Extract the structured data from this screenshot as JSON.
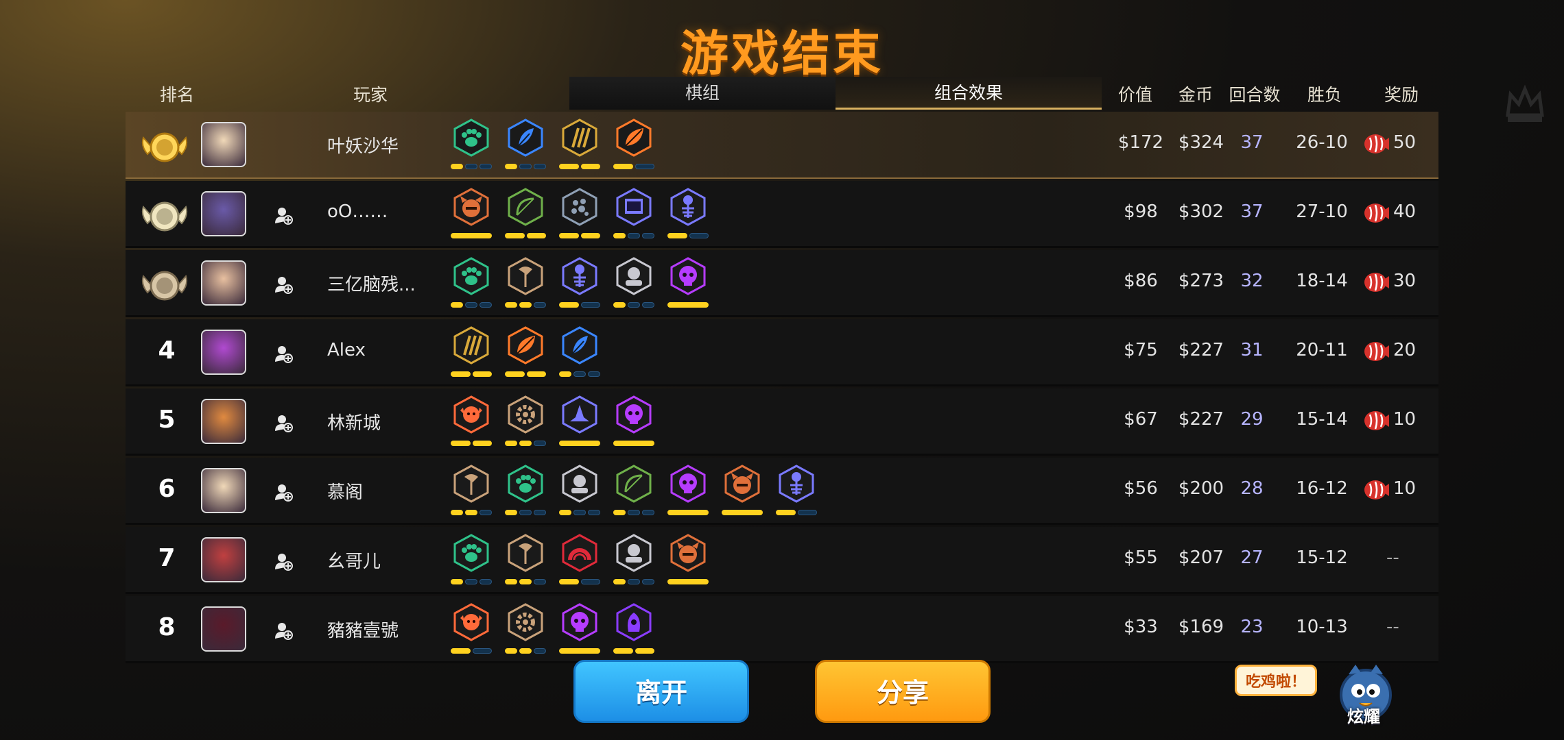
{
  "title": "游戏结束",
  "headers": {
    "rank": "排名",
    "player": "玩家",
    "value": "价值",
    "gold": "金币",
    "rounds": "回合数",
    "winloss": "胜负",
    "reward": "奖励"
  },
  "tabs": {
    "deck": "棋组",
    "synergy": "组合效果"
  },
  "colors": {
    "title": "#ff9a1f",
    "active_bar": "#ffd21f",
    "inactive_bar": "#13324d",
    "round_text": "#b7b5ff"
  },
  "players": [
    {
      "rank": "1",
      "medal": "gold",
      "name": "叶妖沙华",
      "value": "$172",
      "gold": "$324",
      "rounds": "37",
      "record": "26-10",
      "reward": "50",
      "synergies": [
        {
          "icon": "paw",
          "color": "#2fc28a",
          "bars": [
            1,
            0,
            0
          ]
        },
        {
          "icon": "feather",
          "color": "#3a86ff",
          "bars": [
            1,
            0,
            0
          ]
        },
        {
          "icon": "claw",
          "color": "#d9a93a",
          "bars": [
            1,
            1
          ]
        },
        {
          "icon": "leaf",
          "color": "#ff7a2a",
          "bars": [
            1,
            0
          ]
        }
      ]
    },
    {
      "rank": "2",
      "medal": "silver",
      "name": "oO……",
      "value": "$98",
      "gold": "$302",
      "rounds": "37",
      "record": "27-10",
      "reward": "40",
      "synergies": [
        {
          "icon": "demon",
          "color": "#e0703a",
          "bars": [
            1
          ]
        },
        {
          "icon": "bow",
          "color": "#6fb04a",
          "bars": [
            1,
            1
          ]
        },
        {
          "icon": "spots",
          "color": "#8fa0b5",
          "bars": [
            1,
            1
          ]
        },
        {
          "icon": "book",
          "color": "#7a7aff",
          "bars": [
            1,
            0,
            0
          ]
        },
        {
          "icon": "fishbone",
          "color": "#7a7aff",
          "bars": [
            1,
            0
          ]
        }
      ]
    },
    {
      "rank": "3",
      "medal": "bronze",
      "name": "三亿脑残...",
      "value": "$86",
      "gold": "$273",
      "rounds": "32",
      "record": "18-14",
      "reward": "30",
      "synergies": [
        {
          "icon": "paw",
          "color": "#2fc28a",
          "bars": [
            1,
            0,
            0
          ]
        },
        {
          "icon": "axe",
          "color": "#c9a27a",
          "bars": [
            1,
            1,
            0
          ]
        },
        {
          "icon": "fishbone",
          "color": "#7a7aff",
          "bars": [
            1,
            0
          ]
        },
        {
          "icon": "knight",
          "color": "#c8c8d0",
          "bars": [
            1,
            0,
            0
          ]
        },
        {
          "icon": "skull",
          "color": "#b63cff",
          "bars": [
            1
          ]
        }
      ]
    },
    {
      "rank": "4",
      "medal": "",
      "name": "Alex",
      "value": "$75",
      "gold": "$227",
      "rounds": "31",
      "record": "20-11",
      "reward": "20",
      "synergies": [
        {
          "icon": "claw",
          "color": "#d9a93a",
          "bars": [
            1,
            1
          ]
        },
        {
          "icon": "leaf",
          "color": "#ff7a2a",
          "bars": [
            1,
            1
          ]
        },
        {
          "icon": "feather",
          "color": "#3a86ff",
          "bars": [
            1,
            0,
            0
          ]
        }
      ]
    },
    {
      "rank": "5",
      "medal": "",
      "name": "林新城",
      "value": "$67",
      "gold": "$227",
      "rounds": "29",
      "record": "15-14",
      "reward": "10",
      "synergies": [
        {
          "icon": "goblin",
          "color": "#ff6a3a",
          "bars": [
            1,
            1
          ]
        },
        {
          "icon": "gear",
          "color": "#c9a27a",
          "bars": [
            1,
            1,
            0
          ]
        },
        {
          "icon": "hat",
          "color": "#7a7aff",
          "bars": [
            1
          ]
        },
        {
          "icon": "skull",
          "color": "#b63cff",
          "bars": [
            1
          ]
        }
      ]
    },
    {
      "rank": "6",
      "medal": "",
      "name": "慕阁",
      "value": "$56",
      "gold": "$200",
      "rounds": "28",
      "record": "16-12",
      "reward": "10",
      "synergies": [
        {
          "icon": "axe",
          "color": "#c9a27a",
          "bars": [
            1,
            1,
            0
          ]
        },
        {
          "icon": "paw",
          "color": "#2fc28a",
          "bars": [
            1,
            0,
            0
          ]
        },
        {
          "icon": "knight",
          "color": "#c8c8d0",
          "bars": [
            1,
            0,
            0
          ]
        },
        {
          "icon": "bow",
          "color": "#6fb04a",
          "bars": [
            1,
            0,
            0
          ]
        },
        {
          "icon": "skull",
          "color": "#b63cff",
          "bars": [
            1
          ]
        },
        {
          "icon": "demon",
          "color": "#e0703a",
          "bars": [
            1
          ]
        },
        {
          "icon": "fishbone",
          "color": "#7a7aff",
          "bars": [
            1,
            0
          ]
        }
      ]
    },
    {
      "rank": "7",
      "medal": "",
      "name": "幺哥儿",
      "value": "$55",
      "gold": "$207",
      "rounds": "27",
      "record": "15-12",
      "reward": "--",
      "synergies": [
        {
          "icon": "paw",
          "color": "#2fc28a",
          "bars": [
            1,
            0,
            0
          ]
        },
        {
          "icon": "axe",
          "color": "#c9a27a",
          "bars": [
            1,
            1,
            0
          ]
        },
        {
          "icon": "arc",
          "color": "#e02a3a",
          "bars": [
            1,
            0
          ]
        },
        {
          "icon": "knight",
          "color": "#c8c8d0",
          "bars": [
            1,
            0,
            0
          ]
        },
        {
          "icon": "demon",
          "color": "#e0703a",
          "bars": [
            1
          ]
        }
      ]
    },
    {
      "rank": "8",
      "medal": "",
      "name": "豬豬壹號",
      "value": "$33",
      "gold": "$169",
      "rounds": "23",
      "record": "10-13",
      "reward": "--",
      "synergies": [
        {
          "icon": "goblin",
          "color": "#ff6a3a",
          "bars": [
            1,
            0
          ]
        },
        {
          "icon": "gear",
          "color": "#c9a27a",
          "bars": [
            1,
            1,
            0
          ]
        },
        {
          "icon": "skull",
          "color": "#b63cff",
          "bars": [
            1
          ]
        },
        {
          "icon": "spirit",
          "color": "#8a3cff",
          "bars": [
            1,
            1
          ]
        }
      ]
    }
  ],
  "buttons": {
    "leave": "离开",
    "share": "分享"
  },
  "bubble": "吃鸡啦！",
  "mascot_label": "炫耀"
}
